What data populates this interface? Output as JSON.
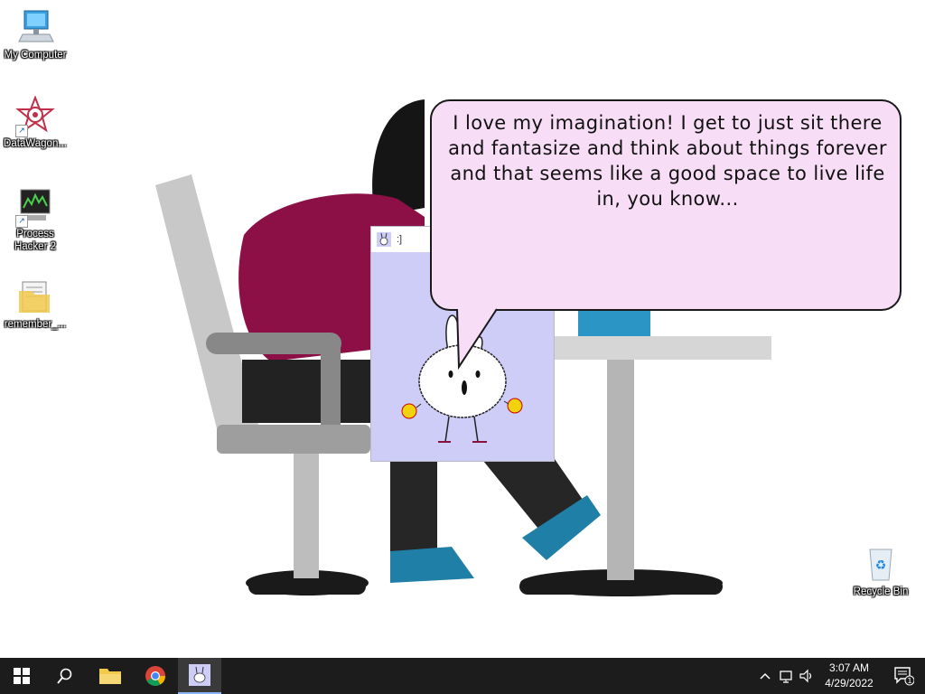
{
  "desktop": {
    "icons": [
      {
        "label": "My Computer",
        "icon": "computer-icon"
      },
      {
        "label": "DataWagon...",
        "icon": "datawagon-icon"
      },
      {
        "label": "Process Hacker 2",
        "icon": "process-hacker-icon"
      },
      {
        "label": "remember_...",
        "icon": "folder-icon"
      },
      {
        "label": "Recycle Bin",
        "icon": "recycle-bin-icon"
      }
    ]
  },
  "app_window": {
    "title": ":]",
    "icon": "bunny-icon"
  },
  "speech_bubble": {
    "text": "I love my imagination! I get to just sit there and fantasize and think about things forever and that seems like a good space to live life in, you know..."
  },
  "taskbar": {
    "buttons": [
      {
        "name": "start",
        "icon": "windows-logo-icon"
      },
      {
        "name": "search",
        "icon": "search-icon"
      },
      {
        "name": "file-explorer",
        "icon": "folder-icon"
      },
      {
        "name": "chrome",
        "icon": "chrome-icon"
      },
      {
        "name": "bunny-app",
        "icon": "bunny-icon",
        "active": true
      }
    ],
    "tray": {
      "icons": [
        "chevron-up-icon",
        "network-icon",
        "volume-icon"
      ],
      "time": "3:07 AM",
      "date": "4/29/2022",
      "notification_count": "1"
    }
  },
  "colors": {
    "taskbar": "#1c1c1c",
    "bubble_fill": "#f8ddf6",
    "app_background": "#cdcdf8",
    "wallpaper_shirt": "#8c1046",
    "wallpaper_shoe": "#1f7fa6"
  }
}
